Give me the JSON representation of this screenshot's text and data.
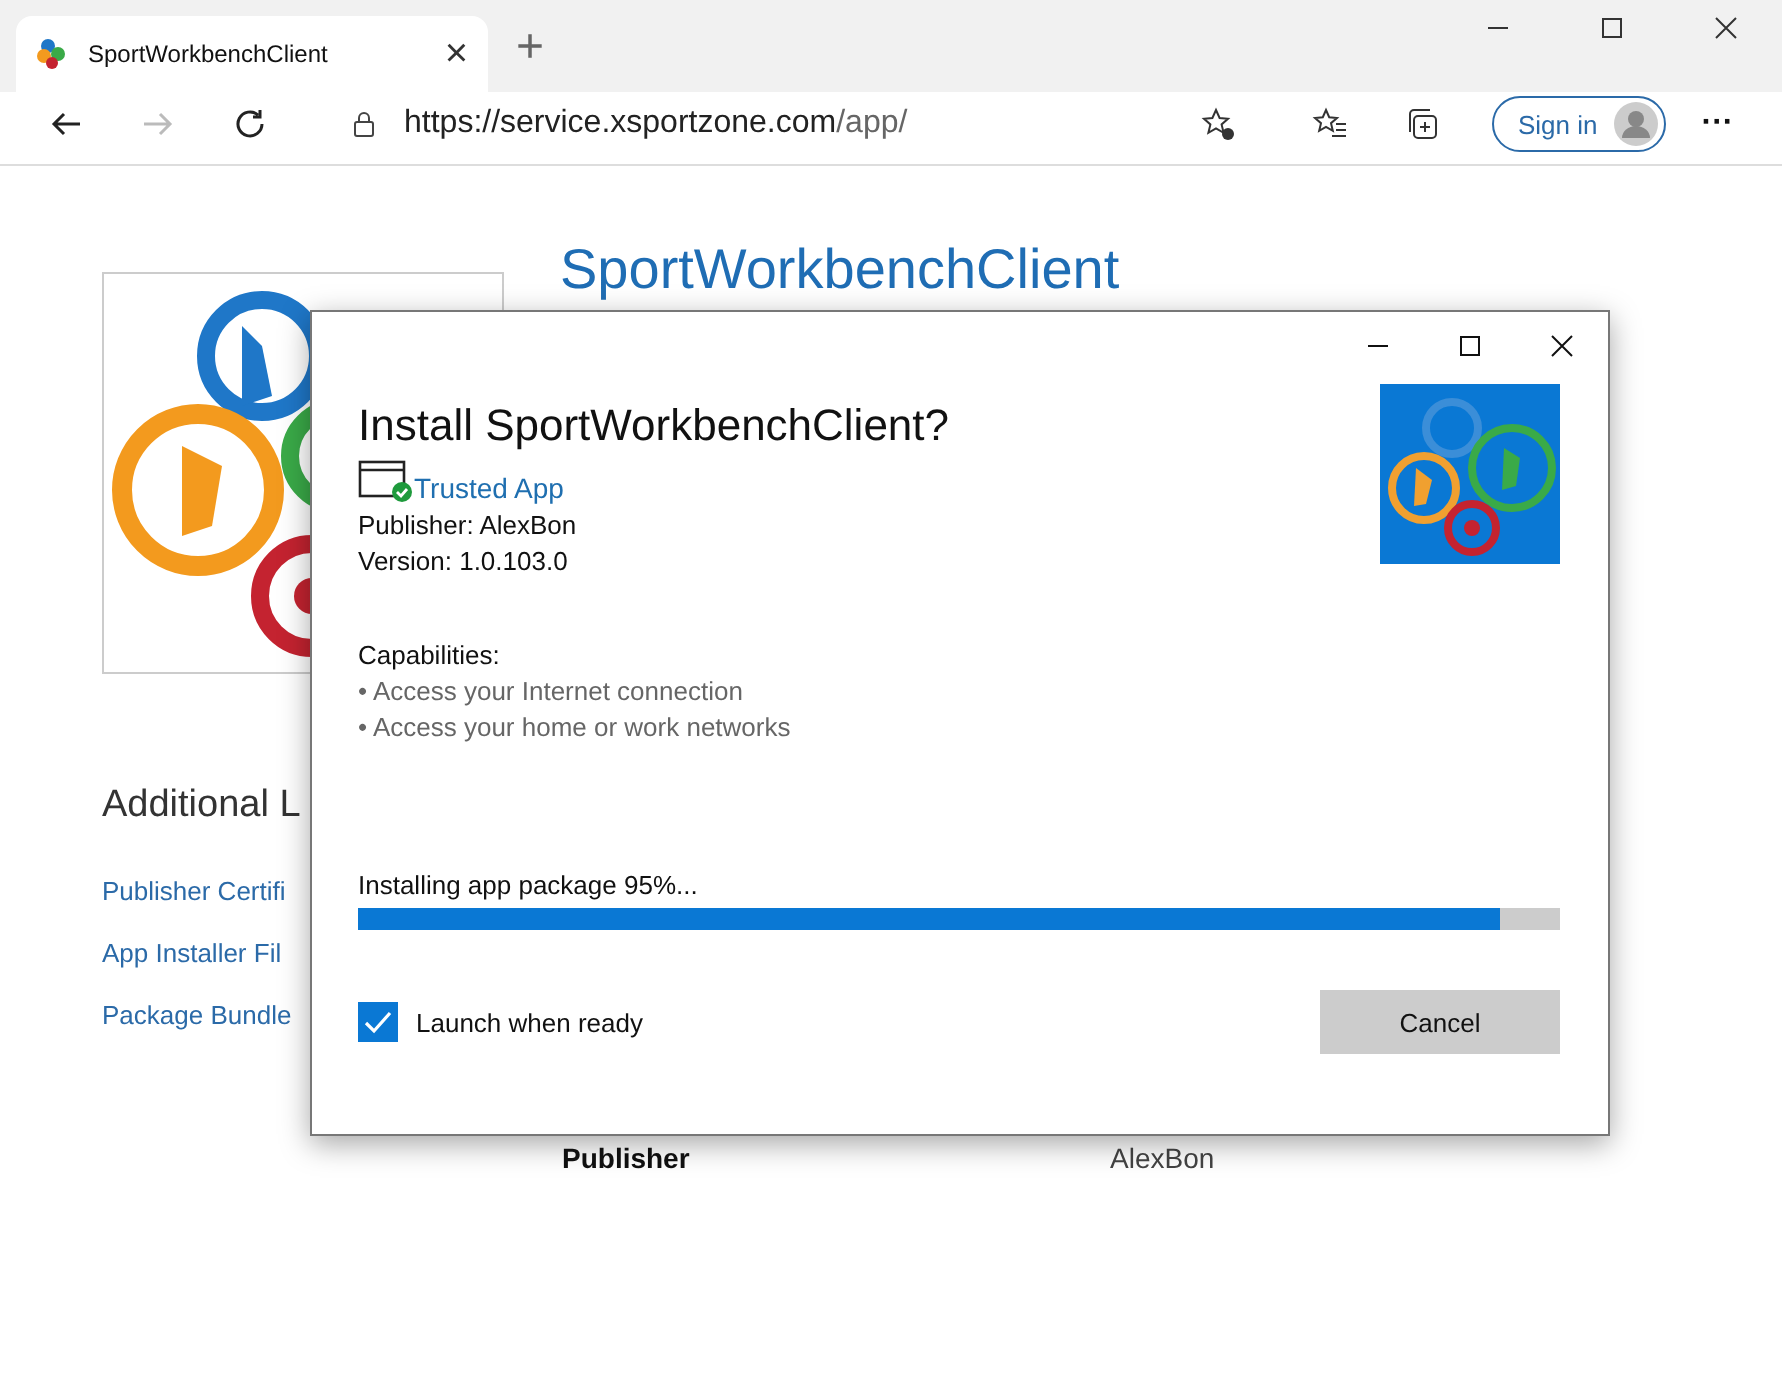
{
  "browser": {
    "tab": {
      "title": "SportWorkbenchClient",
      "close": "×"
    },
    "new_tab": "+",
    "address": {
      "host": "https://service.xsportzone.com",
      "path": "/app/"
    },
    "sign_in": "Sign in",
    "more": "···"
  },
  "page": {
    "heading": "SportWorkbenchClient",
    "section_title": "Additional L",
    "links": [
      "Publisher Certifi",
      "App Installer Fil",
      "Package Bundle"
    ],
    "info_rows": [
      {
        "label": "Publisher",
        "value": "AlexBon"
      }
    ]
  },
  "dialog": {
    "title": "Install SportWorkbenchClient?",
    "trust_label": "Trusted App",
    "publisher": "Publisher: AlexBon",
    "version": "Version: 1.0.103.0",
    "capabilities_label": "Capabilities:",
    "capabilities": [
      "• Access your Internet connection",
      "• Access your home or work networks"
    ],
    "progress": {
      "label": "Installing app package 95%...",
      "level": 0.95
    },
    "launch": {
      "label": "Launch when ready",
      "checked": true
    },
    "cancel": "Cancel"
  }
}
